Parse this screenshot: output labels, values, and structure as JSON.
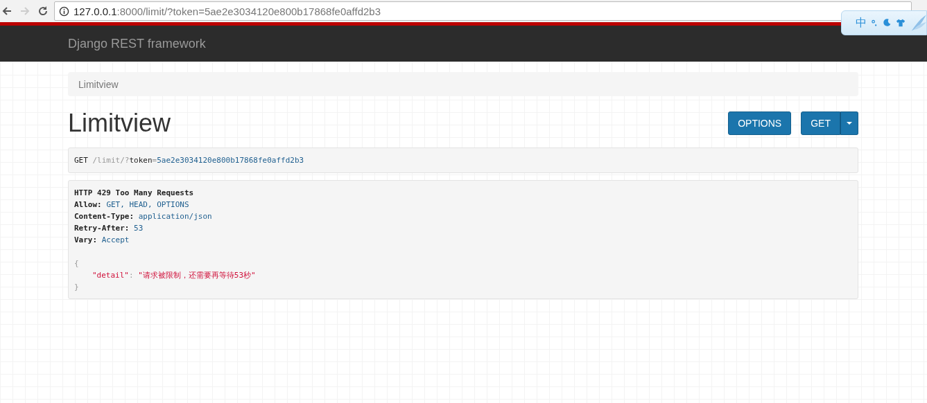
{
  "browser": {
    "url_host": "127.0.0.1",
    "url_rest": ":8000/limit/?token=5ae2e3034120e800b17868fe0affd2b3",
    "back_enabled": true,
    "forward_enabled": false
  },
  "ime_toolbar": {
    "label": "中"
  },
  "navbar": {
    "brand": "Django REST framework"
  },
  "breadcrumb": [
    {
      "label": "Limitview",
      "selected": true
    }
  ],
  "page": {
    "title": "Limitview",
    "buttons": [
      {
        "label": "OPTIONS",
        "kind": "plain"
      },
      {
        "label": "GET",
        "kind": "split"
      }
    ]
  },
  "request": {
    "segments": [
      {
        "text": "GET ",
        "kind": "method"
      },
      {
        "text": "/limit/?",
        "kind": "path"
      },
      {
        "text": "token",
        "kind": "key"
      },
      {
        "text": "=",
        "kind": "path"
      },
      {
        "text": "5ae2e3034120e800b17868fe0affd2b3",
        "kind": "value"
      }
    ]
  },
  "response": {
    "status": "HTTP 429 Too Many Requests",
    "headers": [
      {
        "name": "Allow:",
        "value": "GET, HEAD, OPTIONS"
      },
      {
        "name": "Content-Type:",
        "value": "application/json"
      },
      {
        "name": "Retry-After:",
        "value": "53"
      },
      {
        "name": "Vary:",
        "value": "Accept"
      }
    ],
    "body": {
      "open": "{",
      "key": "\"detail\"",
      "colon": ":",
      "value": "\"请求被限制，还需要再等待53秒\"",
      "close": "}"
    }
  }
}
